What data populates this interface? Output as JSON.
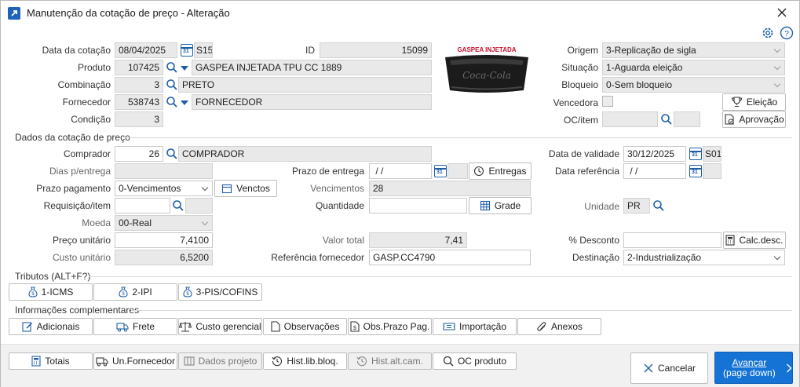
{
  "window": {
    "title": "Manutenção da cotação de preço - Alteração",
    "close_icon": "close-icon",
    "app_icon": "external-link-icon"
  },
  "header": {
    "data_cotacao_label": "Data da cotação",
    "data_cotacao": "08/04/2025",
    "data_cotacao_code": "S15",
    "id_label": "ID",
    "id": "15099",
    "produto_label": "Produto",
    "produto_code": "107425",
    "produto_desc": "GASPEA INJETADA TPU CC 1889",
    "combinacao_label": "Combinação",
    "combinacao_code": "3",
    "combinacao_desc": "PRETO",
    "fornecedor_label": "Fornecedor",
    "fornecedor_code": "538743",
    "fornecedor_desc": "FORNECEDOR",
    "condicao_label": "Condição",
    "condicao": "3",
    "image_caption": "GASPEA INJETADA",
    "image_logo": "Coca-Cola",
    "origem_label": "Origem",
    "origem": "3-Replicação de sigla",
    "situacao_label": "Situação",
    "situacao": "1-Aguarda eleição",
    "bloqueio_label": "Bloqueio",
    "bloqueio": "0-Sem bloqueio",
    "vencedora_label": "Vencedora",
    "oc_item_label": "OC/item",
    "eleicao_button": "Eleição",
    "aprovacao_button": "Aprovação"
  },
  "dados": {
    "section_title": "Dados da cotação de preço",
    "comprador_label": "Comprador",
    "comprador_code": "26",
    "comprador_desc": "COMPRADOR",
    "data_validade_label": "Data de validade",
    "data_validade": "30/12/2025",
    "data_validade_code": "S01",
    "dias_entrega_label": "Dias p/entrega",
    "prazo_entrega_label": "Prazo de entrega",
    "prazo_entrega": " / /",
    "entregas_button": "Entregas",
    "data_referencia_label": "Data referência",
    "data_referencia": " / /",
    "prazo_pagamento_label": "Prazo pagamento",
    "prazo_pagamento": "0-Vencimentos",
    "venctos_button": "Venctos",
    "vencimentos_label": "Vencimentos",
    "vencimentos": "28",
    "requisicao_label": "Requisição/item",
    "quantidade_label": "Quantidade",
    "grade_button": "Grade",
    "unidade_label": "Unidade",
    "unidade": "PR",
    "moeda_label": "Moeda",
    "moeda": "00-Real",
    "preco_unitario_label": "Preço unitário",
    "preco_unitario": "7,4100",
    "valor_total_label": "Valor total",
    "valor_total": "7,41",
    "desconto_label": "% Desconto",
    "calc_desc_button": "Calc.desc.",
    "custo_unitario_label": "Custo unitário",
    "custo_unitario": "6,5200",
    "ref_fornecedor_label": "Referência fornecedor",
    "ref_fornecedor": "GASP.CC4790",
    "destinacao_label": "Destinação",
    "destinacao": "2-Industrialização"
  },
  "tributos": {
    "section_title": "Tributos (ALT+F?)",
    "buttons": [
      "1-ICMS",
      "2-IPI",
      "3-PIS/COFINS"
    ]
  },
  "complementares": {
    "section_title": "Informações complementares",
    "buttons": [
      "Adicionais",
      "Frete",
      "Custo gerencial",
      "Observações",
      "Obs.Prazo Pag.",
      "Importação",
      "Anexos"
    ]
  },
  "footer": {
    "buttons": [
      "Totais",
      "Un.Fornecedor",
      "Dados projeto",
      "Hist.lib.bloq.",
      "Hist.alt.cam.",
      "OC produto"
    ],
    "cancel": "Cancelar",
    "advance": "Avançar",
    "advance_sub": "(page down)"
  }
}
